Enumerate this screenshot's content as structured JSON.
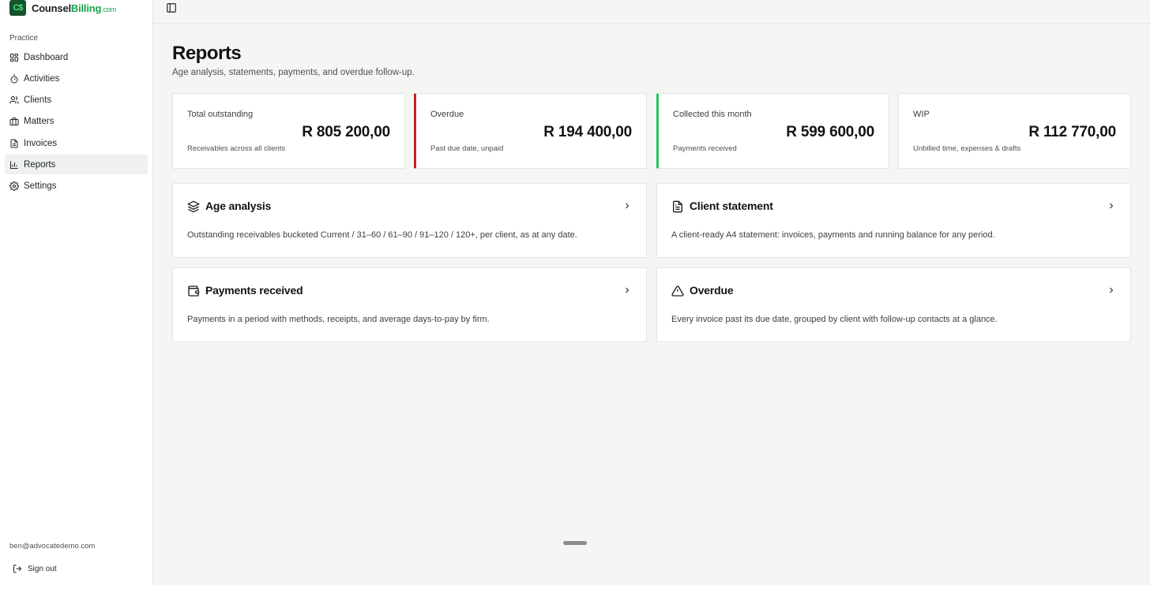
{
  "brand": {
    "logo_text": "C$",
    "name_part1": "Counsel",
    "name_part2": "Billing",
    "name_suffix": ".com"
  },
  "sidebar": {
    "section_label": "Practice",
    "items": [
      {
        "label": "Dashboard",
        "icon": "dashboard-icon"
      },
      {
        "label": "Activities",
        "icon": "stopwatch-icon"
      },
      {
        "label": "Clients",
        "icon": "users-icon"
      },
      {
        "label": "Matters",
        "icon": "briefcase-icon"
      },
      {
        "label": "Invoices",
        "icon": "document-icon"
      },
      {
        "label": "Reports",
        "icon": "bar-chart-icon",
        "active": true
      },
      {
        "label": "Settings",
        "icon": "gear-icon"
      }
    ],
    "user_email": "ben@advocatedemo.com",
    "signout_label": "Sign out"
  },
  "page": {
    "title": "Reports",
    "subtitle": "Age analysis, statements, payments, and overdue follow-up."
  },
  "stats": [
    {
      "label": "Total outstanding",
      "value": "R 805 200,00",
      "note": "Receivables across all clients",
      "accent": ""
    },
    {
      "label": "Overdue",
      "value": "R 194 400,00",
      "note": "Past due date, unpaid",
      "accent": "#c81e1e"
    },
    {
      "label": "Collected this month",
      "value": "R 599 600,00",
      "note": "Payments received",
      "accent": "#22c55e"
    },
    {
      "label": "WIP",
      "value": "R 112 770,00",
      "note": "Unbilled time, expenses & drafts",
      "accent": ""
    }
  ],
  "reports": [
    {
      "title": "Age analysis",
      "icon": "layers-icon",
      "description": "Outstanding receivables bucketed Current / 31–60 / 61–90 / 91–120 / 120+, per client, as at any date."
    },
    {
      "title": "Client statement",
      "icon": "file-text-icon",
      "description": "A client-ready A4 statement: invoices, payments and running balance for any period."
    },
    {
      "title": "Payments received",
      "icon": "wallet-icon",
      "description": "Payments in a period with methods, receipts, and average days-to-pay by firm."
    },
    {
      "title": "Overdue",
      "icon": "warning-triangle-icon",
      "description": "Every invoice past its due date, grouped by client with follow-up contacts at a glance."
    }
  ],
  "colors": {
    "brand_dark": "#14532d",
    "brand_green": "#16a34a",
    "overdue_red": "#c81e1e",
    "collected_green": "#22c55e",
    "active_nav_bg": "#eef1ed"
  }
}
